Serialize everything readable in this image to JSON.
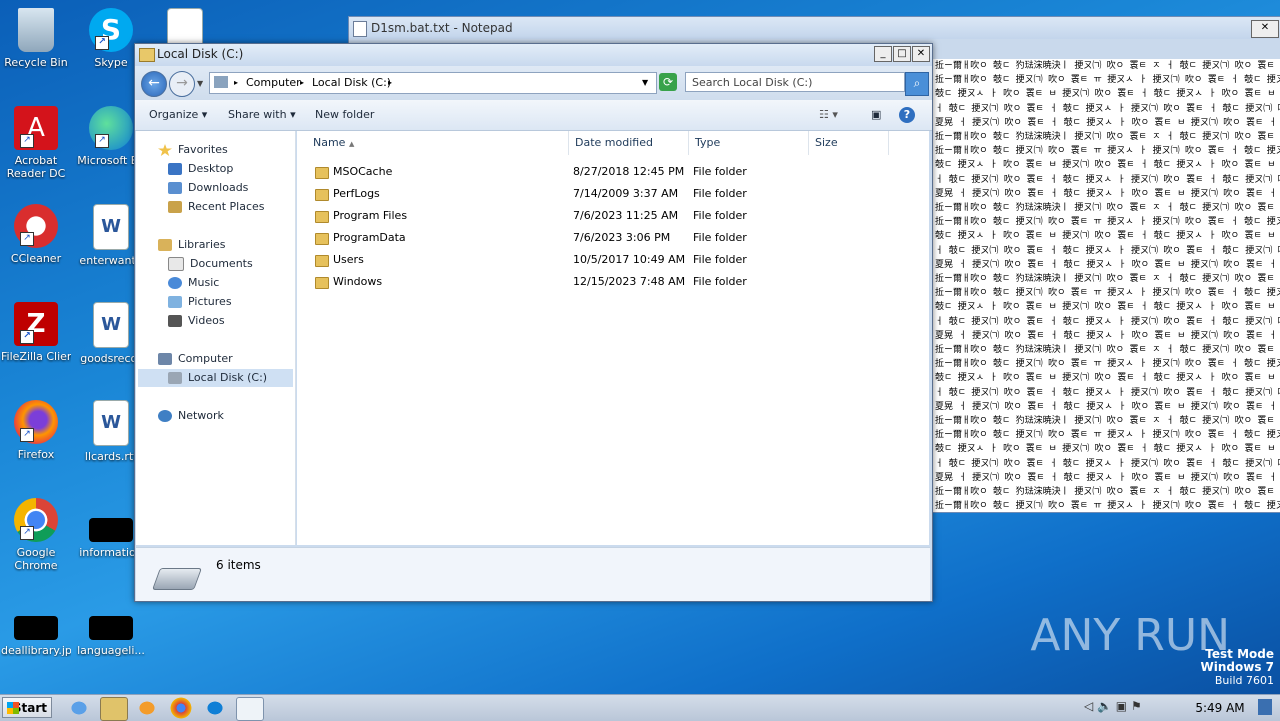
{
  "desktop": {
    "icons": [
      {
        "label": "Recycle Bin"
      },
      {
        "label": "Skype"
      },
      {
        "label": "Acrobat Reader DC"
      },
      {
        "label": "Microsoft Ed"
      },
      {
        "label": "CCleaner"
      },
      {
        "label": "enterwante"
      },
      {
        "label": "FileZilla Client"
      },
      {
        "label": "goodsrecor"
      },
      {
        "label": "Firefox"
      },
      {
        "label": "llcards.rtf"
      },
      {
        "label": "Google Chrome"
      },
      {
        "label": "information"
      },
      {
        "label": "deallibrary.jpg"
      },
      {
        "label": "languageli..."
      }
    ]
  },
  "notepad": {
    "title": "D1sm.bat.txt - Notepad",
    "lines": [
      "拞ㄧ爾ㅐ吹ㅇ 攲ㄷ 犳琺浨暁決ㅣ 挭ㄡ㈀ 吹ㅇ 瞏ㅌ ㅈ ㅓ 攲ㄷ 挭ㄡ㈀ 吹ㅇ 瞏ㅌ ㅎ ㅓ 攲ㄷ",
      "拞ㄧ爾ㅐ吹ㅇ 攲ㄷ 挭ㄡ㈀ 吹ㅇ 瞏ㅌ ㅠ 挭ㄡㅅ ㅏ 挭ㄡ㈀ 吹ㅇ 瞏ㅌ ㅓ 攲ㄷ 挭ㄡㅅ ㅏ",
      "攲ㄷ 挭ㄡㅅ ㅏ 吹ㅇ 瞏ㅌ ㅂ 挭ㄡ㈀ 吹ㅇ 瞏ㅌ ㅓ 攲ㄷ 挭ㄡㅅ ㅏ 吹ㅇ 瞏ㅌ ㅂ 挭ㄡ㈀",
      "ㅓ 攲ㄷ 挭ㄡ㈀ 吹ㅇ 瞏ㅌ ㅓ 攲ㄷ 挭ㄡㅅ ㅏ 挭ㄡ㈀ 吹ㅇ 瞏ㅌ ㅓ 攲ㄷ 挭ㄡ㈀ 吹ㅇ",
      "夏晃 ㅓ 挭ㄡ㈀ 吹ㅇ 瞏ㅌ ㅓ 攲ㄷ 挭ㄡㅅ ㅏ 吹ㅇ 瞏ㅌ ㅂ 挭ㄡ㈀ 吹ㅇ 瞏ㅌ ㅓ 攲ㄷ"
    ]
  },
  "explorer": {
    "title": "Local Disk (C:)",
    "address_parts": [
      "Computer",
      "Local Disk (C:)"
    ],
    "search_placeholder": "Search Local Disk (C:)",
    "toolbar": {
      "organize": "Organize",
      "share_with": "Share with",
      "new_folder": "New folder"
    },
    "nav": {
      "favorites": "Favorites",
      "favorites_items": [
        "Desktop",
        "Downloads",
        "Recent Places"
      ],
      "libraries": "Libraries",
      "libraries_items": [
        "Documents",
        "Music",
        "Pictures",
        "Videos"
      ],
      "computer": "Computer",
      "computer_items": [
        "Local Disk (C:)"
      ],
      "network": "Network"
    },
    "columns": [
      "Name",
      "Date modified",
      "Type",
      "Size"
    ],
    "rows": [
      {
        "name": "MSOCache",
        "date": "8/27/2018 12:45 PM",
        "type": "File folder",
        "locked": true
      },
      {
        "name": "PerfLogs",
        "date": "7/14/2009 3:37 AM",
        "type": "File folder",
        "locked": false
      },
      {
        "name": "Program Files",
        "date": "7/6/2023 11:25 AM",
        "type": "File folder",
        "locked": false
      },
      {
        "name": "ProgramData",
        "date": "7/6/2023 3:06 PM",
        "type": "File folder",
        "locked": false
      },
      {
        "name": "Users",
        "date": "10/5/2017 10:49 AM",
        "type": "File folder",
        "locked": false
      },
      {
        "name": "Windows",
        "date": "12/15/2023 7:48 AM",
        "type": "File folder",
        "locked": false
      }
    ],
    "status": "6 items"
  },
  "taskbar": {
    "start": "Start",
    "clock": "5:49 AM"
  },
  "watermark": {
    "line1": "Test Mode",
    "line2": "Windows 7",
    "line3": "Build 7601",
    "brand": "ANY RUN"
  }
}
